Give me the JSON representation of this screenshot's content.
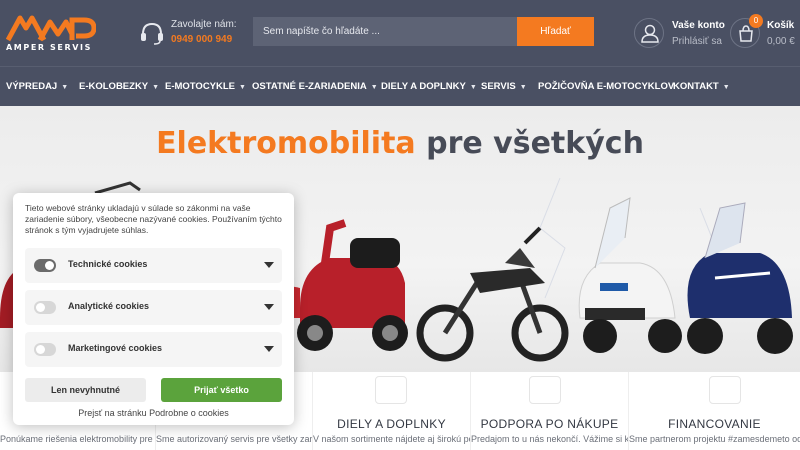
{
  "header": {
    "logo_text": "AMPER SERVIS",
    "phone_label": "Zavolajte nám:",
    "phone_number": "0949 000 949",
    "search_placeholder": "Sem napíšte čo hľadáte ...",
    "search_button": "Hľadať",
    "account_title": "Vaše konto",
    "account_sub": "Prihlásiť sa",
    "cart_title": "Košík",
    "cart_sub": "0,00 €",
    "cart_count": "0"
  },
  "nav": {
    "items": [
      {
        "label": "VÝPREDAJ"
      },
      {
        "label": "E-KOLOBEZKY"
      },
      {
        "label": "E-MOTOCYKLE"
      },
      {
        "label": "OSTATNÉ E-ZARIADENIA"
      },
      {
        "label": "DIELY A DOPLNKY"
      },
      {
        "label": "SERVIS"
      },
      {
        "label": "POŽIČOVŇA E-MOTOCYKLOV"
      },
      {
        "label": "KONTAKT"
      }
    ]
  },
  "hero": {
    "title_accent": "Elektromobilita",
    "title_rest": " pre všetkých"
  },
  "features": [
    {
      "title": "",
      "text": "Ponúkame riešenia elektromobility pre všetky vekové kategórie, od"
    },
    {
      "title": "",
      "text": "Sme autorizovaný servis pre všetky zariadenia v našej ponuke. Opravy vš"
    },
    {
      "title": "DIELY A DOPLNKY",
      "text": "V našom sortimente nájdete aj širokú ponuku dielov a doplnkov. Všetky"
    },
    {
      "title": "PODPORA PO NÁKUPE",
      "text": "Predajom to u nás nekončí. Vážime si každého zákazníka a"
    },
    {
      "title": "FINANCOVANIE",
      "text": "Sme partnerom projektu #zamesdemeto od Tatrabanky, vďaka"
    }
  ],
  "cookie": {
    "text": "Tieto webové stránky ukladajú v súlade so zákonmi na vaše zariadenie súbory, všeobecne nazývané cookies. Používaním týchto stránok s tým vyjadrujete súhlas.",
    "rows": [
      {
        "label": "Technické cookies",
        "enabled": true
      },
      {
        "label": "Analytické cookies",
        "enabled": false
      },
      {
        "label": "Marketingové cookies",
        "enabled": false
      }
    ],
    "btn_necessary": "Len nevyhnutné",
    "btn_accept": "Prijať všetko",
    "link_prefix": "Prejsť na stránku ",
    "link_text": "Podrobne o cookies"
  },
  "colors": {
    "header_bg": "#4a5063",
    "accent": "#f47a20",
    "accept_green": "#5ba33c"
  }
}
